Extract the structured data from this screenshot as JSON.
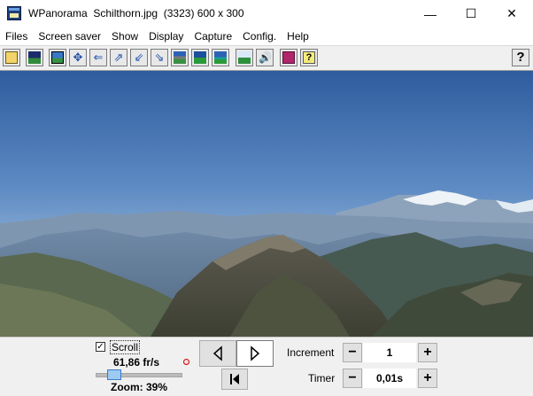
{
  "window": {
    "app_name": "WPanorama",
    "file_name": "Schilthorn.jpg",
    "info": "(3323) 600 x 300",
    "minimize_glyph": "—",
    "maximize_glyph": "☐",
    "close_glyph": "✕"
  },
  "menu": [
    "Files",
    "Screen saver",
    "Show",
    "Display",
    "Capture",
    "Config.",
    "Help"
  ],
  "toolbar": {
    "buttons": [
      "open-file-icon",
      "picture-icon",
      "fit-image-icon",
      "expand-icon",
      "scroll-left-icon",
      "scroll-up-right-icon",
      "shrink-icon",
      "scroll-down-right-icon",
      "image-panel-icon",
      "landscape-icon",
      "horizon-icon",
      "mountain-icon",
      "sound-icon",
      "book-icon",
      "about-icon"
    ],
    "help_label": "?"
  },
  "controls": {
    "scroll_label": "Scroll",
    "scroll_checked": "✓",
    "fps": "61,86 fr/s",
    "zoom_label": "Zoom: 39%",
    "zoom_percent": 39,
    "increment_label": "Increment",
    "increment_value": "1",
    "timer_label": "Timer",
    "timer_value": "0,01s",
    "minus": "−",
    "plus": "+"
  },
  "colors": {
    "sky_top": "#2e5c9e",
    "sky_bottom": "#b7cfe5",
    "slider_thumb": "#9ccaf2"
  }
}
